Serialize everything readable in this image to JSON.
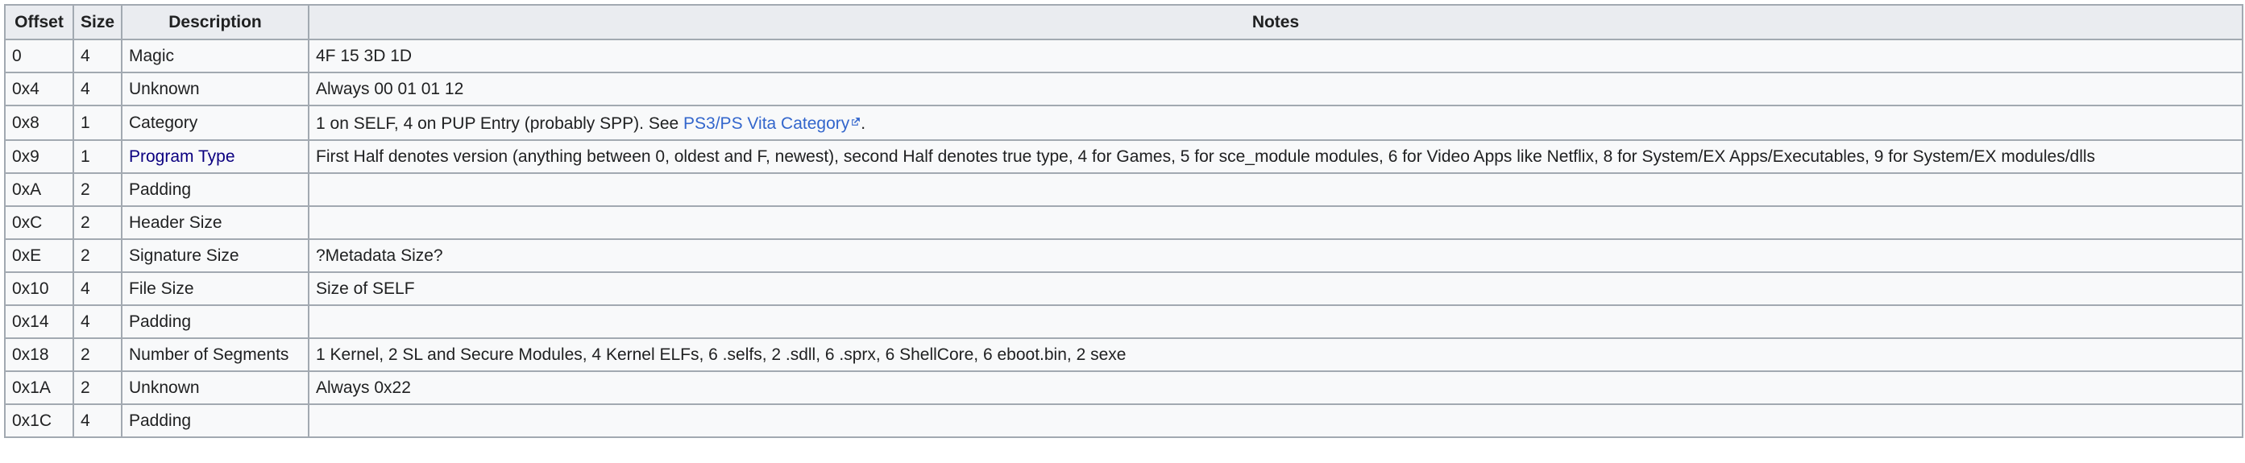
{
  "headers": [
    "Offset",
    "Size",
    "Description",
    "Notes"
  ],
  "rows": [
    {
      "offset": "0",
      "size": "4",
      "description": "Magic",
      "notes": "4F 15 3D 1D"
    },
    {
      "offset": "0x4",
      "size": "4",
      "description": "Unknown",
      "notes": "Always 00 01 01 12"
    },
    {
      "offset": "0x8",
      "size": "1",
      "description": "Category",
      "notes_prefix": "1 on SELF, 4 on PUP Entry (probably SPP). See ",
      "notes_link": "PS3/PS Vita Category",
      "notes_suffix": "."
    },
    {
      "offset": "0x9",
      "size": "1",
      "description": "Program Type",
      "notes": "First Half denotes version (anything between 0, oldest and F, newest), second Half denotes true type, 4 for Games, 5 for sce_module modules, 6 for Video Apps like Netflix, 8 for System/EX Apps/Executables, 9 for System/EX modules/dlls"
    },
    {
      "offset": "0xA",
      "size": "2",
      "description": "Padding",
      "notes": ""
    },
    {
      "offset": "0xC",
      "size": "2",
      "description": "Header Size",
      "notes": ""
    },
    {
      "offset": "0xE",
      "size": "2",
      "description": "Signature Size",
      "notes": "?Metadata Size?"
    },
    {
      "offset": "0x10",
      "size": "4",
      "description": "File Size",
      "notes": "Size of SELF"
    },
    {
      "offset": "0x14",
      "size": "4",
      "description": "Padding",
      "notes": ""
    },
    {
      "offset": "0x18",
      "size": "2",
      "description": "Number of Segments",
      "notes": "1 Kernel, 2 SL and Secure Modules, 4 Kernel ELFs, 6 .selfs, 2 .sdll, 6 .sprx, 6 ShellCore, 6 eboot.bin, 2 sexe"
    },
    {
      "offset": "0x1A",
      "size": "2",
      "description": "Unknown",
      "notes": "Always 0x22"
    },
    {
      "offset": "0x1C",
      "size": "4",
      "description": "Padding",
      "notes": ""
    }
  ],
  "colors": {
    "header_bg": "#eaecf0",
    "cell_bg": "#f8f9fa",
    "border": "#a2a9b1",
    "link": "#3366cc",
    "visited_link": "#0b0080"
  },
  "icons": {
    "external_link": "external-link-icon"
  }
}
